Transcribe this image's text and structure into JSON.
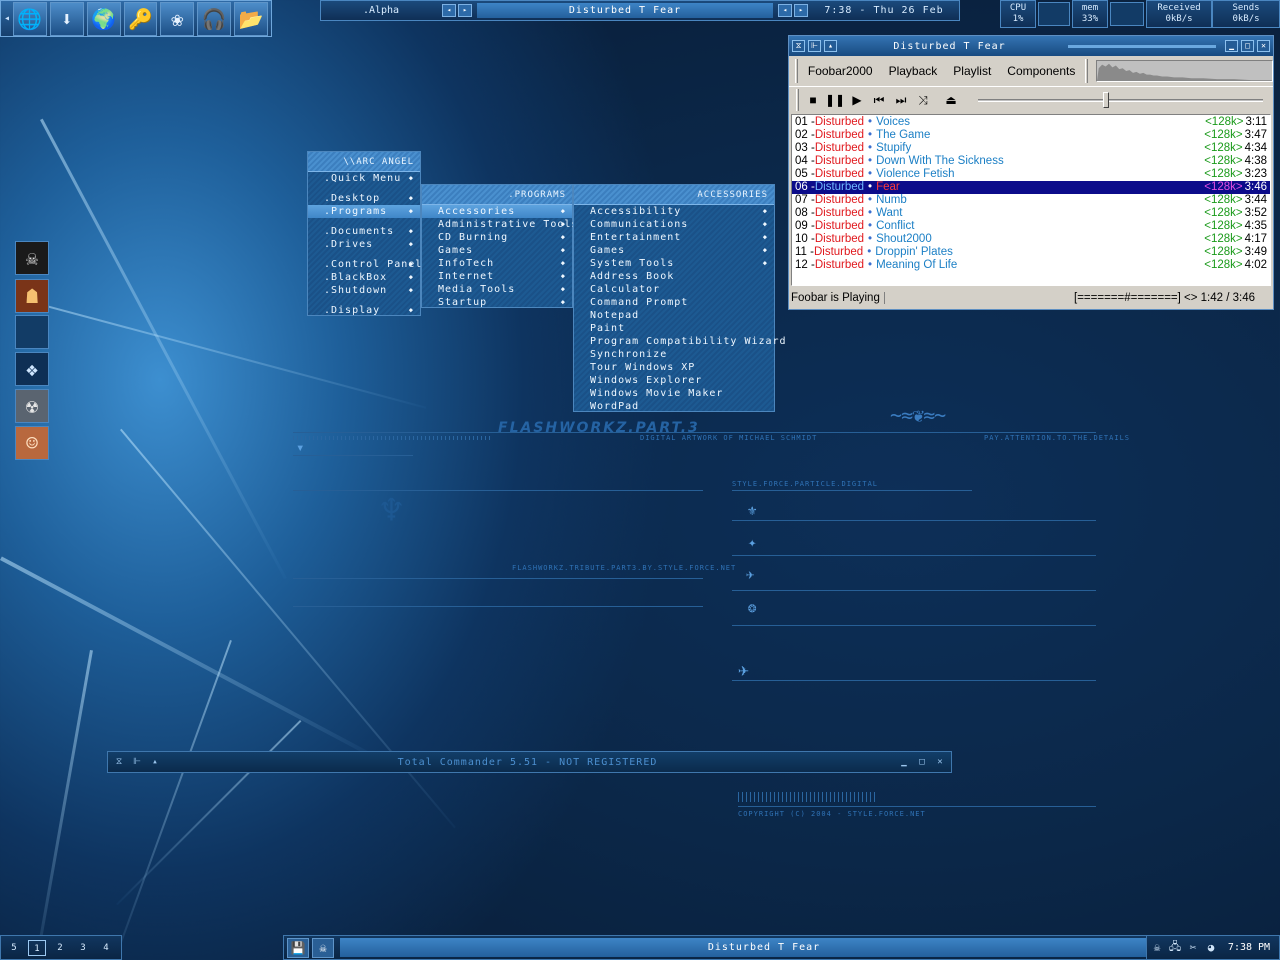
{
  "launcher": {
    "arrow": "◂",
    "buttons": [
      {
        "icon": "globe-icon",
        "glyph": "🌐"
      },
      {
        "icon": "download-arrow-icon",
        "glyph": "⬇"
      },
      {
        "icon": "browser-icon",
        "glyph": "🌍"
      },
      {
        "icon": "keys-icon",
        "glyph": "🔑"
      },
      {
        "icon": "lotus-icon",
        "glyph": "❀"
      },
      {
        "icon": "headphones-icon",
        "glyph": "🎧"
      },
      {
        "icon": "folder-files-icon",
        "glyph": "📂"
      }
    ]
  },
  "topbar": {
    "workspace": ".Alpha",
    "prev": "◂",
    "next": "▸",
    "window_title": "Disturbed T Fear",
    "clock": "7:38 - Thu 26 Feb"
  },
  "sysmon": {
    "cpu_label": "CPU",
    "cpu_value": "1%",
    "mem_label": "mem",
    "mem_value": "33%",
    "recv_label": "Received",
    "recv_value": "0kB/s",
    "send_label": "Sends",
    "send_value": "0kB/s"
  },
  "menus": {
    "root": {
      "header": "\\\\ARC ANGEL",
      "items": [
        ".Quick Menu",
        "",
        ".Desktop",
        ".Programs",
        "",
        ".Documents",
        ".Drives",
        "",
        ".Control Panel",
        ".BlackBox",
        ".Shutdown",
        "",
        ".Display"
      ]
    },
    "programs": {
      "header": ".PROGRAMS",
      "items": [
        "Accessories",
        "Administrative Tools",
        "CD Burning",
        "Games",
        "InfoTech",
        "Internet",
        "Media Tools",
        "Startup"
      ]
    },
    "accessories": {
      "header": "ACCESSORIES",
      "items": [
        "Accessibility",
        "Communications",
        "Entertainment",
        "Games",
        "System Tools",
        "Address Book",
        "Calculator",
        "Command Prompt",
        "Notepad",
        "Paint",
        "Program Compatibility Wizard",
        "Synchronize",
        "Tour Windows XP",
        "Windows Explorer",
        "Windows Movie Maker",
        "WordPad"
      ]
    }
  },
  "foobar": {
    "title": "Disturbed T Fear",
    "menu": [
      "Foobar2000",
      "Playback",
      "Playlist",
      "Components"
    ],
    "status_left": "Foobar is Playing",
    "status_right": "[=======#=======] <> 1:42 / 3:46",
    "seek_fraction": 0.45,
    "playlist": [
      {
        "num": "01 - ",
        "artist": "Disturbed",
        "title": "Voices",
        "bitrate": "<128k>",
        "dur": "3:11"
      },
      {
        "num": "02 - ",
        "artist": "Disturbed",
        "title": "The Game",
        "bitrate": "<128k>",
        "dur": "3:47"
      },
      {
        "num": "03 - ",
        "artist": "Disturbed",
        "title": "Stupify",
        "bitrate": "<128k>",
        "dur": "4:34"
      },
      {
        "num": "04 - ",
        "artist": "Disturbed",
        "title": "Down With The Sickness",
        "bitrate": "<128k>",
        "dur": "4:38"
      },
      {
        "num": "05 - ",
        "artist": "Disturbed",
        "title": "Violence Fetish",
        "bitrate": "<128k>",
        "dur": "3:23"
      },
      {
        "num": "06 - ",
        "artist": "Disturbed",
        "title": "Fear",
        "bitrate": "<128k>",
        "dur": "3:46"
      },
      {
        "num": "07 - ",
        "artist": "Disturbed",
        "title": "Numb",
        "bitrate": "<128k>",
        "dur": "3:44"
      },
      {
        "num": "08 - ",
        "artist": "Disturbed",
        "title": "Want",
        "bitrate": "<128k>",
        "dur": "3:52"
      },
      {
        "num": "09 - ",
        "artist": "Disturbed",
        "title": "Conflict",
        "bitrate": "<128k>",
        "dur": "4:35"
      },
      {
        "num": "10 - ",
        "artist": "Disturbed",
        "title": "Shout2000",
        "bitrate": "<128k>",
        "dur": "4:17"
      },
      {
        "num": "11 - ",
        "artist": "Disturbed",
        "title": "Droppin' Plates",
        "bitrate": "<128k>",
        "dur": "3:49"
      },
      {
        "num": "12 - ",
        "artist": "Disturbed",
        "title": "Meaning Of Life",
        "bitrate": "<128k>",
        "dur": "4:02"
      }
    ],
    "active_index": 5
  },
  "total_commander": {
    "title": "Total Commander 5.51 - NOT REGISTERED"
  },
  "wallpaper": {
    "flashworkz": "FLASHWORKZ.PART.3",
    "line1": "DIGITAL ARTWORK OF MICHAEL SCHMIDT",
    "line2": "PAY.ATTENTION.TO.THE.DETAILS",
    "line3": "STYLE.FORCE.PARTICLE.DIGITAL",
    "line4": "FLASHWORKZ.TRIBUTE.PART3.BY.STYLE.FORCE.NET",
    "copyright": "COPYRIGHT (C) 2004 - STYLE.FORCE.NET"
  },
  "bottom": {
    "desktops": [
      "5",
      "1",
      "2",
      "3",
      "4"
    ],
    "current_desktop": 1,
    "task": "Disturbed T Fear",
    "clock": "7:38 PM"
  },
  "colors": {
    "accent": "#3d84c6",
    "playlist_artist": "#e0181d",
    "playlist_title": "#1b7fc5",
    "playlist_bitrate": "#1a9a1a",
    "playlist_active_bg": "#0c0c8a"
  }
}
